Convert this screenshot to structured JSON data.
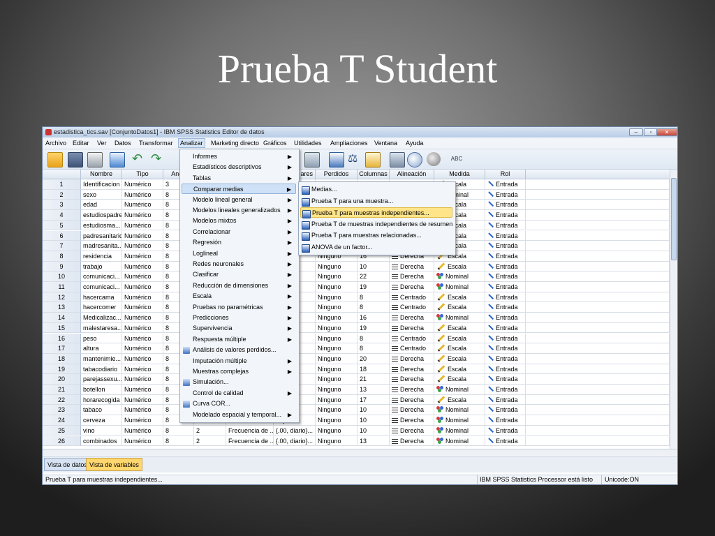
{
  "slide": {
    "title": "Prueba T Student"
  },
  "window": {
    "title": "estadistica_tics.sav [ConjuntoDatos1] - IBM SPSS Statistics Editor de datos",
    "controls": {
      "minimize": "–",
      "maximize": "▫",
      "close": "✕"
    }
  },
  "menubar": [
    "Archivo",
    "Editar",
    "Ver",
    "Datos",
    "Transformar",
    "Analizar",
    "Marketing directo",
    "Gráficos",
    "Utilidades",
    "Ampliaciones",
    "Ventana",
    "Ayuda"
  ],
  "columns": [
    "Nombre",
    "Tipo",
    "Anch",
    "ares",
    "Perdidos",
    "Columnas",
    "Alineación",
    "Medida",
    "Rol"
  ],
  "rows": [
    {
      "n": "1",
      "nombre": "Identificacion",
      "tipo": "Numérico",
      "anch": "3",
      "ares": "",
      "perdidos": "",
      "columnas": "",
      "alineacion": "",
      "medida": "Escala",
      "rol": "Entrada"
    },
    {
      "n": "2",
      "nombre": "sexo",
      "tipo": "Numérico",
      "anch": "8",
      "ares": "",
      "perdidos": "",
      "columnas": "",
      "alineacion": "",
      "medida": "Nominal",
      "rol": "Entrada"
    },
    {
      "n": "3",
      "nombre": "edad",
      "tipo": "Numérico",
      "anch": "8",
      "ares": "",
      "perdidos": "",
      "columnas": "",
      "alineacion": "",
      "medida": "Escala",
      "rol": "Entrada"
    },
    {
      "n": "4",
      "nombre": "estudiospadre",
      "tipo": "Numérico",
      "anch": "8",
      "ares": "",
      "perdidos": "",
      "columnas": "",
      "alineacion": "",
      "medida": "Escala",
      "rol": "Entrada"
    },
    {
      "n": "5",
      "nombre": "estudiosma...",
      "tipo": "Numérico",
      "anch": "8",
      "ares": "",
      "perdidos": "",
      "columnas": "",
      "alineacion": "",
      "medida": "Escala",
      "rol": "Entrada"
    },
    {
      "n": "6",
      "nombre": "padresanitario",
      "tipo": "Numérico",
      "anch": "8",
      "ares": "",
      "perdidos": "",
      "columnas": "",
      "alineacion": "",
      "medida": "Escala",
      "rol": "Entrada"
    },
    {
      "n": "7",
      "nombre": "madresanita...",
      "tipo": "Numérico",
      "anch": "8",
      "ares": "",
      "perdidos": "",
      "columnas": "",
      "alineacion": "",
      "medida": "Escala",
      "rol": "Entrada"
    },
    {
      "n": "8",
      "nombre": "residencia",
      "tipo": "Numérico",
      "anch": "8",
      "ares": "iliar",
      "perdidos": "Ninguno",
      "columnas": "16",
      "alineacion": "Derecha",
      "medida": "Escala",
      "rol": "Entrada"
    },
    {
      "n": "9",
      "nombre": "trabajo",
      "tipo": "Numérico",
      "anch": "8",
      "ares": "",
      "perdidos": "Ninguno",
      "columnas": "10",
      "alineacion": "Derecha",
      "medida": "Escala",
      "rol": "Entrada"
    },
    {
      "n": "10",
      "nombre": "comunicaci...",
      "tipo": "Numérico",
      "anch": "8",
      "ares": "",
      "perdidos": "Ninguno",
      "columnas": "22",
      "alineacion": "Derecha",
      "medida": "Nominal",
      "rol": "Entrada"
    },
    {
      "n": "11",
      "nombre": "comunicaci...",
      "tipo": "Numérico",
      "anch": "8",
      "ares": "",
      "perdidos": "Ninguno",
      "columnas": "19",
      "alineacion": "Derecha",
      "medida": "Nominal",
      "rol": "Entrada"
    },
    {
      "n": "12",
      "nombre": "hacercama",
      "tipo": "Numérico",
      "anch": "8",
      "ares": "a)...",
      "perdidos": "Ninguno",
      "columnas": "8",
      "alineacion": "Centrado",
      "medida": "Escala",
      "rol": "Entrada"
    },
    {
      "n": "13",
      "nombre": "hacercomer",
      "tipo": "Numérico",
      "anch": "8",
      "ares": "a)...",
      "perdidos": "Ninguno",
      "columnas": "8",
      "alineacion": "Centrado",
      "medida": "Escala",
      "rol": "Entrada"
    },
    {
      "n": "14",
      "nombre": "Medicalizac...",
      "tipo": "Numérico",
      "anch": "8",
      "ares": "",
      "perdidos": "Ninguno",
      "columnas": "16",
      "alineacion": "Derecha",
      "medida": "Nominal",
      "rol": "Entrada"
    },
    {
      "n": "15",
      "nombre": "malestaresa...",
      "tipo": "Numérico",
      "anch": "8",
      "ares": "",
      "perdidos": "Ninguno",
      "columnas": "19",
      "alineacion": "Derecha",
      "medida": "Escala",
      "rol": "Entrada"
    },
    {
      "n": "16",
      "nombre": "peso",
      "tipo": "Numérico",
      "anch": "8",
      "ares": "",
      "perdidos": "Ninguno",
      "columnas": "8",
      "alineacion": "Centrado",
      "medida": "Escala",
      "rol": "Entrada"
    },
    {
      "n": "17",
      "nombre": "altura",
      "tipo": "Numérico",
      "anch": "8",
      "ares": "",
      "perdidos": "Ninguno",
      "columnas": "8",
      "alineacion": "Centrado",
      "medida": "Escala",
      "rol": "Entrada"
    },
    {
      "n": "18",
      "nombre": "mantenimie...",
      "tipo": "Numérico",
      "anch": "8",
      "ares": "",
      "perdidos": "Ninguno",
      "columnas": "20",
      "alineacion": "Derecha",
      "medida": "Escala",
      "rol": "Entrada"
    },
    {
      "n": "19",
      "nombre": "tabacodiario",
      "tipo": "Numérico",
      "anch": "8",
      "ares": "ma...",
      "perdidos": "Ninguno",
      "columnas": "18",
      "alineacion": "Derecha",
      "medida": "Escala",
      "rol": "Entrada"
    },
    {
      "n": "20",
      "nombre": "parejassexu...",
      "tipo": "Numérico",
      "anch": "8",
      "ares": "nas}...",
      "perdidos": "Ninguno",
      "columnas": "21",
      "alineacion": "Derecha",
      "medida": "Escala",
      "rol": "Entrada"
    },
    {
      "n": "21",
      "nombre": "botellon",
      "tipo": "Numérico",
      "anch": "8",
      "ares": "rio}...",
      "perdidos": "Ninguno",
      "columnas": "13",
      "alineacion": "Derecha",
      "medida": "Nominal",
      "rol": "Entrada"
    },
    {
      "n": "22",
      "nombre": "horarecogida",
      "tipo": "Numérico",
      "anch": "8",
      "ares": "ues...",
      "perdidos": "Ninguno",
      "columnas": "17",
      "alineacion": "Derecha",
      "medida": "Escala",
      "rol": "Entrada"
    },
    {
      "n": "23",
      "nombre": "tabaco",
      "tipo": "Numérico",
      "anch": "8",
      "ares": "rio}...",
      "perdidos": "Ninguno",
      "columnas": "10",
      "alineacion": "Derecha",
      "medida": "Nominal",
      "rol": "Entrada"
    },
    {
      "n": "24",
      "nombre": "cerveza",
      "tipo": "Numérico",
      "anch": "8",
      "ares": "rio}...",
      "perdidos": "Ninguno",
      "columnas": "10",
      "alineacion": "Derecha",
      "medida": "Nominal",
      "rol": "Entrada"
    },
    {
      "n": "25",
      "nombre": "vino",
      "tipo": "Numérico",
      "anch": "8",
      "decim": "2",
      "etiqueta": "Frecuencia de ...",
      "ares": "{.00, diario}...",
      "perdidos": "Ninguno",
      "columnas": "10",
      "alineacion": "Derecha",
      "medida": "Nominal",
      "rol": "Entrada"
    },
    {
      "n": "26",
      "nombre": "combinados",
      "tipo": "Numérico",
      "anch": "8",
      "decim": "2",
      "etiqueta": "Frecuencia de ...",
      "ares": "{.00, diario}...",
      "perdidos": "Ninguno",
      "columnas": "13",
      "alineacion": "Derecha",
      "medida": "Nominal",
      "rol": "Entrada"
    }
  ],
  "analizar_menu": [
    {
      "label": "Informes",
      "sub": true
    },
    {
      "label": "Estadísticos descriptivos",
      "sub": true
    },
    {
      "label": "Tablas",
      "sub": true
    },
    {
      "label": "Comparar medias",
      "sub": true,
      "active": true
    },
    {
      "label": "Modelo lineal general",
      "sub": true
    },
    {
      "label": "Modelos lineales generalizados",
      "sub": true
    },
    {
      "label": "Modelos mixtos",
      "sub": true
    },
    {
      "label": "Correlacionar",
      "sub": true
    },
    {
      "label": "Regresión",
      "sub": true
    },
    {
      "label": "Loglineal",
      "sub": true
    },
    {
      "label": "Redes neuronales",
      "sub": true
    },
    {
      "label": "Clasificar",
      "sub": true
    },
    {
      "label": "Reducción de dimensiones",
      "sub": true
    },
    {
      "label": "Escala",
      "sub": true
    },
    {
      "label": "Pruebas no paramétricas",
      "sub": true
    },
    {
      "label": "Predicciones",
      "sub": true
    },
    {
      "label": "Supervivencia",
      "sub": true
    },
    {
      "label": "Respuesta múltiple",
      "sub": true
    },
    {
      "label": "Análisis de valores perdidos...",
      "sub": false,
      "icon": true
    },
    {
      "label": "Imputación múltiple",
      "sub": true
    },
    {
      "label": "Muestras complejas",
      "sub": true
    },
    {
      "label": "Simulación...",
      "sub": false,
      "icon": true
    },
    {
      "label": "Control de calidad",
      "sub": true
    },
    {
      "label": "Curva COR...",
      "sub": false,
      "icon": true
    },
    {
      "label": "Modelado espacial y temporal...",
      "sub": true
    }
  ],
  "comparar_submenu": [
    {
      "label": "Medias..."
    },
    {
      "label": "Prueba T para una muestra..."
    },
    {
      "label": "Prueba T para muestras independientes...",
      "selected": true
    },
    {
      "label": "Prueba T de muestras independientes de resumen"
    },
    {
      "label": "Prueba T para muestras relacionadas..."
    },
    {
      "label": "ANOVA de un factor..."
    }
  ],
  "tabs": {
    "datos": "Vista de datos",
    "variables": "Vista de variables"
  },
  "status": {
    "left": "Prueba T para muestras independientes...",
    "processor": "IBM SPSS Statistics Processor está listo",
    "unicode": "Unicode:ON"
  },
  "colors": {
    "highlight": "#ffe48a",
    "menu_hover": "#cfe1f6",
    "active_tab": "#ffd76e"
  }
}
